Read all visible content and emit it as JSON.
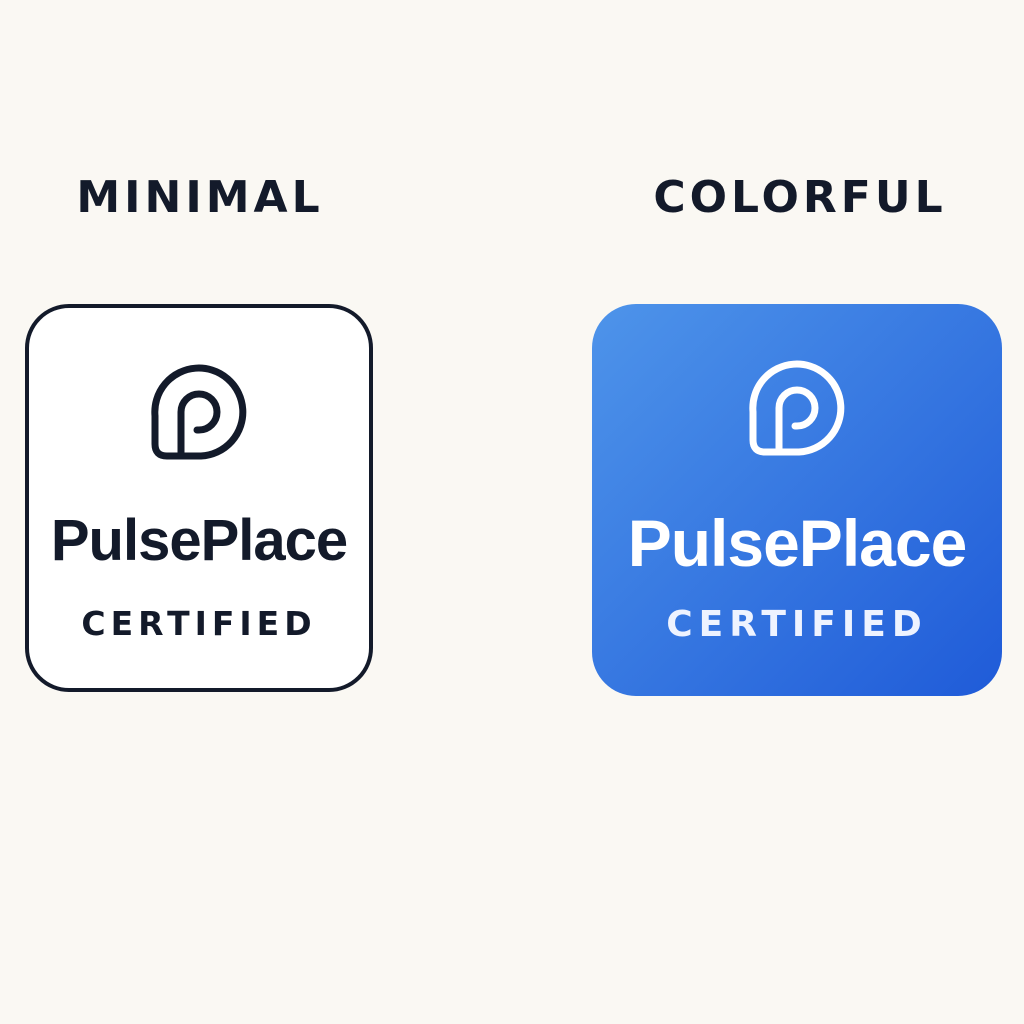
{
  "variants": [
    {
      "title": "MINIMAL",
      "brand_name": "PulsePlace",
      "label": "CERTIFIED",
      "logo_icon": "pulseplace-p-icon",
      "colors": {
        "background": "#ffffff",
        "border": "#131a2a",
        "foreground": "#131a2a"
      }
    },
    {
      "title": "COLORFUL",
      "brand_name": "PulsePlace",
      "label": "CERTIFIED",
      "logo_icon": "pulseplace-p-icon",
      "colors": {
        "gradient_start": "#4e94ea",
        "gradient_end": "#1f5bd8",
        "foreground": "#ffffff"
      }
    }
  ],
  "page_background": "#faf8f3"
}
